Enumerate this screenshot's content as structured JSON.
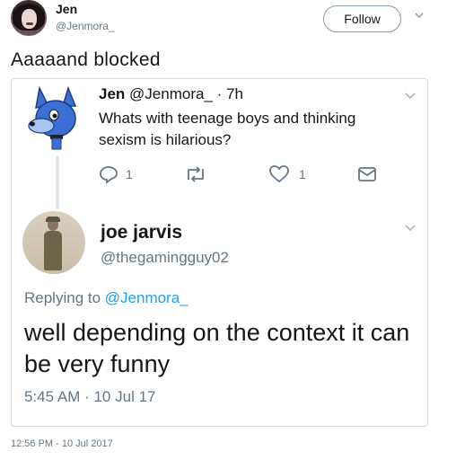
{
  "outer_tweet": {
    "display_name": "Jen",
    "handle": "@Jenmora_",
    "follow_label": "Follow",
    "text": "Aaaaand blocked",
    "timestamp": "12:56 PM - 10 Jul 2017"
  },
  "quoted_thread": {
    "first_tweet": {
      "display_name": "Jen",
      "handle_time": "@Jenmora_ · 7h",
      "text": "Whats with teenage boys and thinking sexism is hilarious?",
      "reply_count": "1",
      "like_count": "1",
      "icons": [
        "reply-icon",
        "retweet-icon",
        "heart-icon",
        "message-icon"
      ]
    },
    "second_tweet": {
      "display_name": "joe jarvis",
      "handle": "@thegamingguy02",
      "replying_prefix": "Replying to",
      "replying_handle": "@Jenmora_",
      "text": "well depending on the context it can be very funny",
      "timestamp": "5:45 AM · 10 Jul 17"
    }
  },
  "colors": {
    "link": "#1da1f2",
    "muted": "#657786",
    "wolf_blue": "#3b6fd4"
  }
}
